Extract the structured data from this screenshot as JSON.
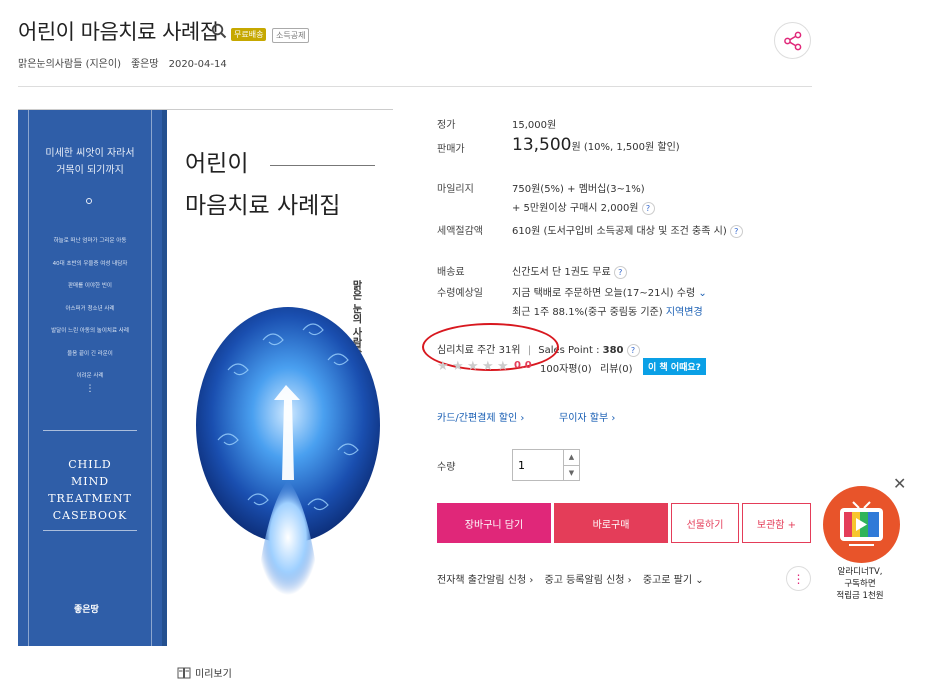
{
  "header": {
    "title": "어린이 마음치료 사례집",
    "badge_free": "무료배송",
    "badge_tax": "소득공제",
    "author": "맑은눈의사람들 (지은이)",
    "publisher": "좋은땅",
    "date": "2020-04-14"
  },
  "cover": {
    "tagline_line1": "미세한 씨앗이 자라서",
    "tagline_line2": "거목이 되기까지",
    "list": [
      "하늘로 떠난 엄마가 그리운 아동",
      "40대 초반의 우울증 여성 내담자",
      "판매를 이야한 빈이",
      "아스퍼거 청소년 사례",
      "발달이 느린 아동의 놀이치료 사례",
      "울음 끝이 긴 라운이",
      "이려운 사례"
    ],
    "vdots": "⋮",
    "english_line1": "CHILD",
    "english_line2": "MIND",
    "english_line3": "TREATMENT",
    "english_line4": "CASEBOOK",
    "publisher_mark": "좋은땅",
    "title_line1": "어린이",
    "title_line2": "마음치료 사례집",
    "author_vertical": "맑은 눈의 사람들 지음"
  },
  "preview_label": "미리보기",
  "info": {
    "list_price_label": "정가",
    "list_price": "15,000원",
    "sale_price_label": "판매가",
    "sale_price": "13,500",
    "sale_unit": "원",
    "sale_discount": "(10%, 1,500원 할인)",
    "mileage_label": "마일리지",
    "mileage_line1": "750원(5%) + 멤버십(3~1%)",
    "mileage_line2": "+ 5만원이상 구매시 2,000원",
    "tax_label": "세액절감액",
    "tax_value": "610원 (도서구입비 소득공제 대상 및 조건 충족 시)",
    "shipping_label": "배송료",
    "shipping_value": "신간도서 단 1권도 무료",
    "delivery_label": "수령예상일",
    "delivery_line1": "지금 택배로 주문하면 오늘(17~21시) 수령",
    "delivery_line2": "최근 1주 88.1%(중구 중림동 기준)",
    "delivery_region": "지역변경",
    "rank_label": "심리치료 주간",
    "rank_value": "31위",
    "sep": "|",
    "sales_point_label": "Sales Point :",
    "sales_point": "380",
    "rating": "0.0",
    "review_100": "100자평(0)",
    "review": "리뷰(0)",
    "how_button": "이 책 어때요?",
    "card_discount": "카드/간편결제 할인 ›",
    "installment": "무이자 할부 ›",
    "qty_label": "수량",
    "qty_value": "1",
    "qmark": "?"
  },
  "buttons": {
    "cart": "장바구니 담기",
    "buy": "바로구매",
    "gift": "선물하기",
    "save": "보관함 +"
  },
  "bottom_links": [
    "전자책 출간알림 신청 ›",
    "중고 등록알림 신청 ›",
    "중고로 팔기 ⌄"
  ],
  "ad": {
    "close": "✕",
    "line1": "알라디너TV,",
    "line2": "구독하면",
    "line3": "적립금 1천원"
  },
  "colors": {
    "pink": "#e02779",
    "red": "#e43d59",
    "blue_link": "#1a5fb4",
    "badge_gold": "#c6a800",
    "cover_blue": "#2f5ea8",
    "how_btn": "#0aa0e6",
    "ellipse": "#d8181f"
  }
}
